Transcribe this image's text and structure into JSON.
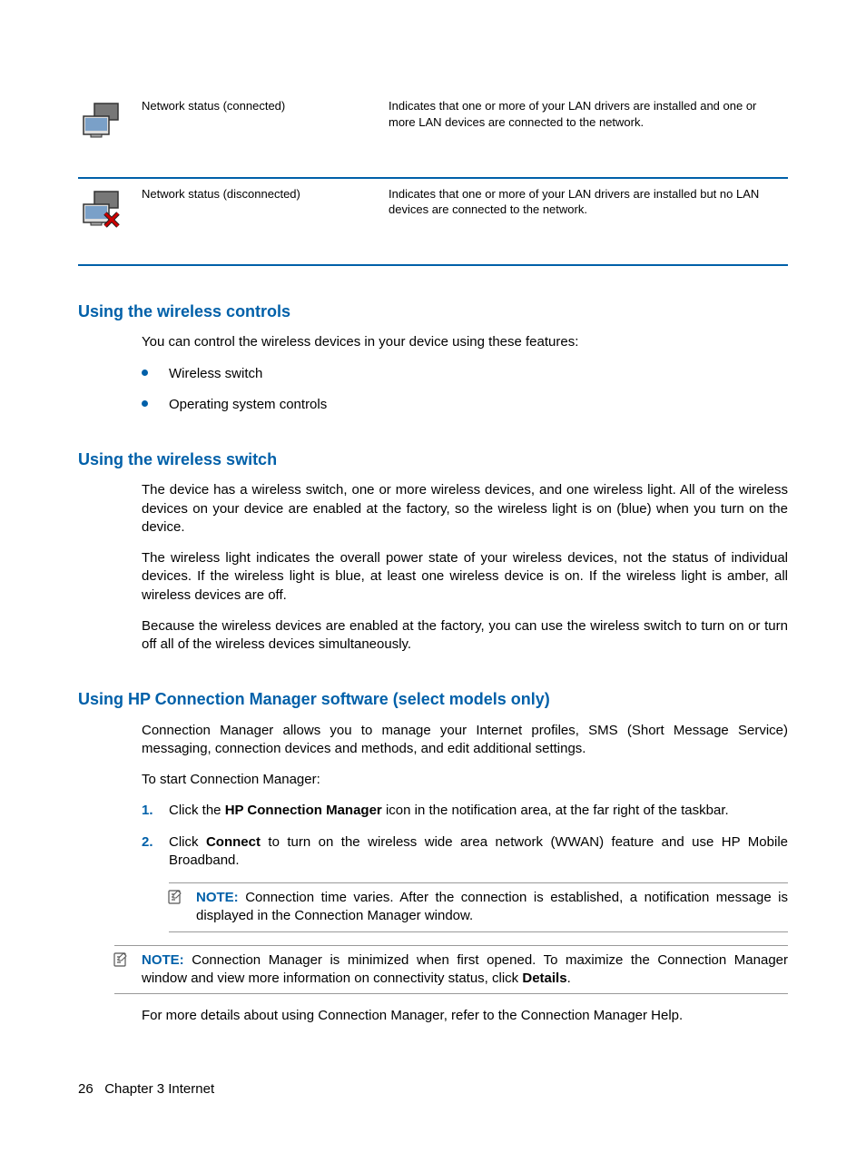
{
  "status_rows": [
    {
      "name": "Network status (connected)",
      "desc": "Indicates that one or more of your LAN drivers are installed and one or more LAN devices are connected to the network."
    },
    {
      "name": "Network status (disconnected)",
      "desc": "Indicates that one or more of your LAN drivers are installed but no LAN devices are connected to the network."
    }
  ],
  "section1": {
    "heading": "Using the wireless controls",
    "intro": "You can control the wireless devices in your device using these features:",
    "bullets": [
      "Wireless switch",
      "Operating system controls"
    ]
  },
  "section2": {
    "heading": "Using the wireless switch",
    "p1": "The device has a wireless switch, one or more wireless devices, and one wireless light. All of the wireless devices on your device are enabled at the factory, so the wireless light is on (blue) when you turn on the device.",
    "p2": "The wireless light indicates the overall power state of your wireless devices, not the status of individual devices. If the wireless light is blue, at least one wireless device is on. If the wireless light is amber, all wireless devices are off.",
    "p3": "Because the wireless devices are enabled at the factory, you can use the wireless switch to turn on or turn off all of the wireless devices simultaneously."
  },
  "section3": {
    "heading": "Using HP Connection Manager software (select models only)",
    "p1": "Connection Manager allows you to manage your Internet profiles, SMS (Short Message Service) messaging, connection devices and methods, and edit additional settings.",
    "p2": "To start Connection Manager:",
    "step1_pre": "Click the ",
    "step1_bold": "HP Connection Manager",
    "step1_post": " icon in the notification area, at the far right of the taskbar.",
    "step2_pre": "Click ",
    "step2_bold": "Connect",
    "step2_post": " to turn on the wireless wide area network (WWAN) feature and use HP Mobile Broadband.",
    "note1_label": "NOTE:",
    "note1_text": "Connection time varies. After the connection is established, a notification message is displayed in the Connection Manager window.",
    "note2_label": "NOTE:",
    "note2_pre": "Connection Manager is minimized when first opened. To maximize the Connection Manager window and view more information on connectivity status, click ",
    "note2_bold": "Details",
    "note2_post": ".",
    "p3": "For more details about using Connection Manager, refer to the Connection Manager Help."
  },
  "footer": {
    "page": "26",
    "chapter": "Chapter 3   Internet"
  }
}
